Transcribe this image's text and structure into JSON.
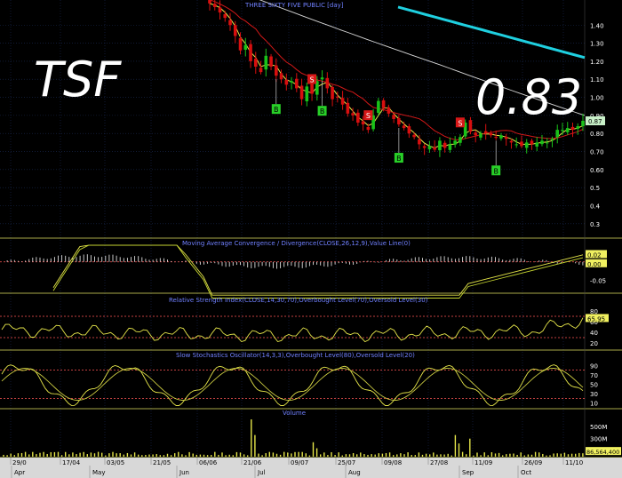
{
  "symbol": "TSF",
  "last_price": "0.83",
  "colors": {
    "background": "#000000",
    "up_candle": "#19c219",
    "down_candle": "#d80f0f",
    "ma_fast": "#e8e84a",
    "ma_mid": "#d01818",
    "ma_slow": "#d8d8d8",
    "ma_long": "#1fd0e0",
    "buy_signal": "#28d028",
    "sell_signal": "#d81818",
    "indicator_line": "#e6e64a",
    "grid": "#1a2a55",
    "level_line": "#ff5555",
    "axis_text": "#ffffff",
    "panel_title": "#7080ff"
  },
  "chart_data": [
    {
      "type": "candlestick",
      "title": "THREE SIXTY FIVE PUBLIC [day]",
      "y_ticks": [
        "1.40",
        "1.30",
        "1.20",
        "1.10",
        "1.00",
        "0.90",
        "0.80",
        "0.70",
        "0.60",
        "0.5",
        "0.4",
        "0.3"
      ],
      "ylim": [
        0.25,
        1.48
      ],
      "last_value_label": "0.87",
      "buy_signals": [
        "B",
        "B",
        "B",
        "B"
      ],
      "sell_signals": [
        "S",
        "S",
        "S"
      ],
      "moving_averages": [
        "fast",
        "mid",
        "slow",
        "long"
      ],
      "series": {
        "close": [
          1.52,
          1.5,
          1.47,
          1.44,
          1.4,
          1.34,
          1.26,
          1.29,
          1.2,
          1.17,
          1.14,
          1.23,
          1.17,
          1.12,
          1.1,
          1.07,
          1.09,
          1.05,
          0.99,
          1.06,
          1.02,
          1.09,
          1.11,
          1.05,
          0.99,
          1.0,
          0.96,
          0.91,
          0.9,
          0.86,
          0.85,
          0.82,
          0.9,
          0.98,
          0.94,
          0.91,
          0.88,
          0.85,
          0.83,
          0.8,
          0.78,
          0.74,
          0.72,
          0.73,
          0.71,
          0.76,
          0.72,
          0.74,
          0.76,
          0.78,
          0.86,
          0.81,
          0.79,
          0.8,
          0.8,
          0.79,
          0.78,
          0.79,
          0.77,
          0.75,
          0.74,
          0.73,
          0.75,
          0.74,
          0.75,
          0.76,
          0.75,
          0.77,
          0.82,
          0.82,
          0.83,
          0.82,
          0.84,
          0.87
        ]
      }
    },
    {
      "type": "line",
      "title": "Moving Average Convergence / Divergence(CLOSE,26,12,9),Value Line(0)",
      "y_ticks": [
        "0.02",
        "0.00",
        "-0.05"
      ],
      "value_labels": [
        "0.02",
        "0.00"
      ],
      "ylim": [
        -0.08,
        0.05
      ]
    },
    {
      "type": "line",
      "title": "Relative Strength Index(CLOSE,14,30,70),Overbought Level(70),Oversold Level(30)",
      "y_ticks": [
        "80",
        "60",
        "40",
        "20"
      ],
      "value_label": "65.95",
      "ylim": [
        10,
        90
      ],
      "levels": [
        70,
        30
      ]
    },
    {
      "type": "line",
      "title": "Slow Stochastics Oscillator(14,3,3),Overbought Level(80),Oversold Level(20)",
      "y_ticks": [
        "90",
        "70",
        "50",
        "30",
        "10"
      ],
      "ylim": [
        0,
        100
      ],
      "levels": [
        80,
        20
      ]
    },
    {
      "type": "bar",
      "title": "Volume",
      "y_ticks": [
        "500M",
        "300M",
        "100M"
      ],
      "value_label": "86,564,400",
      "ylim": [
        0,
        650
      ]
    }
  ],
  "x_axis": {
    "day_labels": [
      "29/0",
      "17/04",
      "03/05",
      "21/05",
      "06/06",
      "21/06",
      "09/07",
      "25/07",
      "09/08",
      "27/08",
      "11/09",
      "26/09",
      "11/10"
    ],
    "month_labels": [
      "Apr",
      "May",
      "Jun",
      "Jul",
      "Aug",
      "Sep",
      "Oct"
    ]
  }
}
